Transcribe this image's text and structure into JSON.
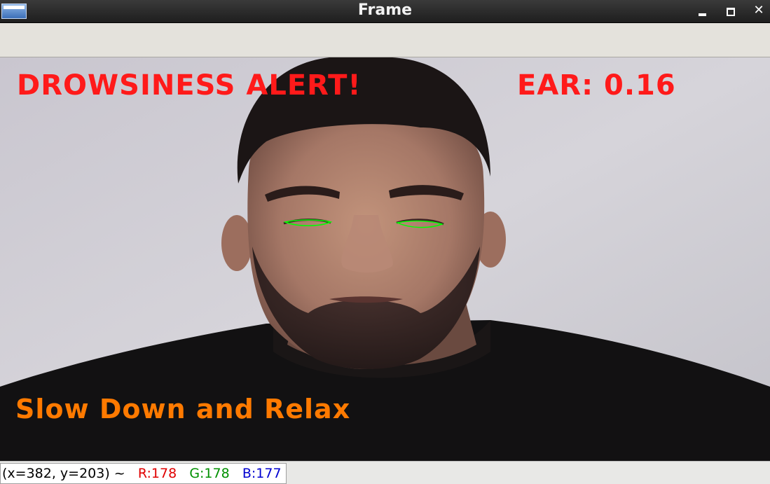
{
  "window": {
    "title": "Frame",
    "buttons": [
      "minimize",
      "maximize",
      "close"
    ],
    "icons": {
      "app": "window-app-icon",
      "minimize": "minimize-icon",
      "maximize": "maximize-icon",
      "close": "close-icon",
      "close_glyph": "✕"
    }
  },
  "overlay": {
    "alert_text": "DROWSINESS ALERT!",
    "ear_text": "EAR: 0.16",
    "relax_text": "Slow Down and Relax",
    "colors": {
      "alert": "#ff1a1a",
      "ear": "#ff1a1a",
      "relax": "#ff7a00",
      "eye_contour": "#00ff00"
    }
  },
  "status": {
    "coords": "(x=382, y=203) ~",
    "r": "R:178",
    "g": "G:178",
    "b": "B:177",
    "colors": {
      "coords": "#000000",
      "r": "#e00000",
      "g": "#009000",
      "b": "#0000d0"
    }
  }
}
